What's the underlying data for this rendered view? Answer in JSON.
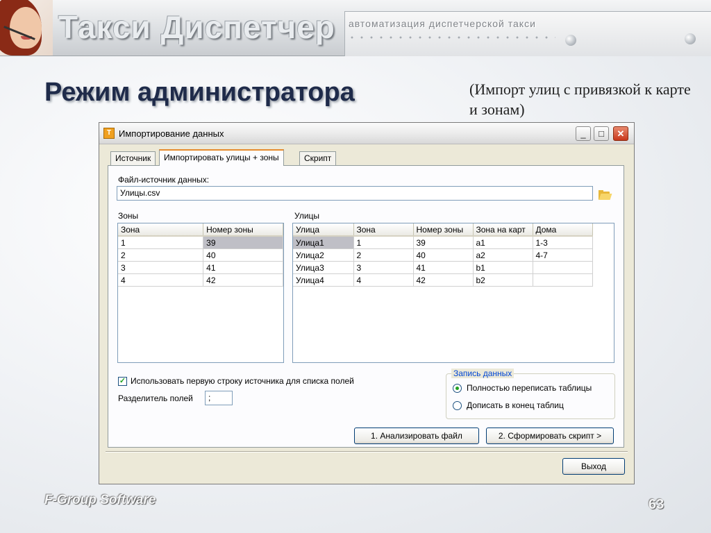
{
  "slide": {
    "banner_title": "Такси Диспетчер",
    "banner_subtitle": "автоматизация диспетчерской такси",
    "title": "Режим администратора",
    "note": "(Импорт улиц с привязкой к карте и зонам)",
    "footer_brand": "F-Group Software",
    "page_number": "63"
  },
  "window": {
    "title": "Импортирование данных",
    "tabs": [
      "Источник",
      "Импортировать улицы + зоны",
      "Скрипт"
    ],
    "active_tab": 1,
    "source_label": "Файл-источник данных:",
    "source_value": "Улицы.csv",
    "zones": {
      "label": "Зоны",
      "columns": [
        "Зона",
        "Номер зоны"
      ],
      "rows": [
        [
          "1",
          "39"
        ],
        [
          "2",
          "40"
        ],
        [
          "3",
          "41"
        ],
        [
          "4",
          "42"
        ]
      ]
    },
    "streets": {
      "label": "Улицы",
      "columns": [
        "Улица",
        "Зона",
        "Номер зоны",
        "Зона на карт",
        "Дома"
      ],
      "rows": [
        [
          "Улица1",
          "1",
          "39",
          "a1",
          "1-3"
        ],
        [
          "Улица2",
          "2",
          "40",
          "a2",
          "4-7"
        ],
        [
          "Улица3",
          "3",
          "41",
          "b1",
          ""
        ],
        [
          "Улица4",
          "4",
          "42",
          "b2",
          ""
        ]
      ]
    },
    "first_row_checkbox": {
      "label": "Использовать первую строку источника для списка полей",
      "checked": true
    },
    "separator_label": "Разделитель полей",
    "separator_value": ";",
    "write_group": {
      "caption": "Запись данных",
      "options": [
        "Полностью переписать таблицы",
        "Дописать в конец таблиц"
      ],
      "selected": 0
    },
    "analyze_button": "1. Анализировать файл",
    "script_button": "2. Сформировать скрипт >",
    "exit_button": "Выход"
  }
}
